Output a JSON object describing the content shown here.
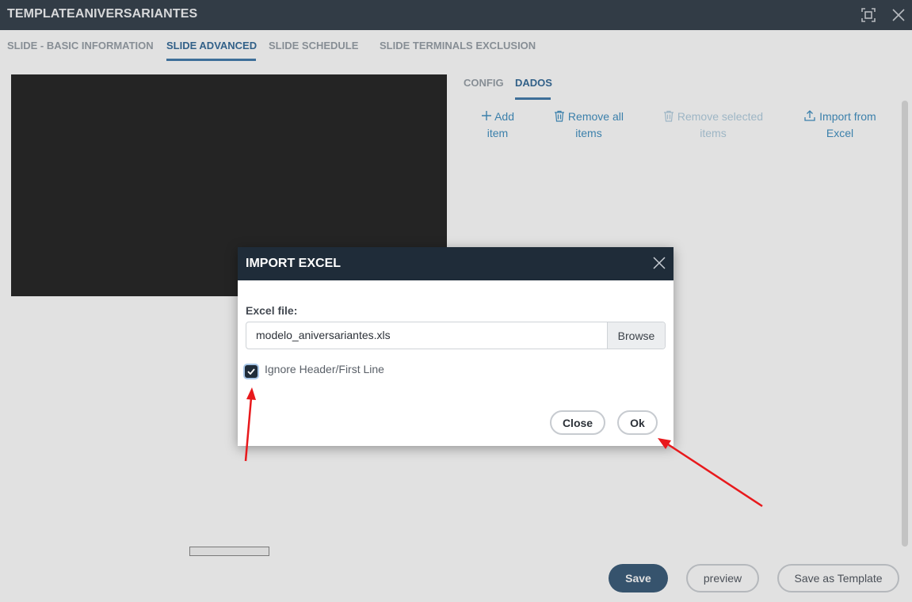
{
  "window": {
    "title": "TEMPLATEANIVERSARIANTES",
    "maximize_icon": "maximize-icon",
    "close_icon": "close-icon"
  },
  "tabs": [
    {
      "label": "SLIDE - BASIC INFORMATION"
    },
    {
      "label": "SLIDE ADVANCED",
      "active": true
    },
    {
      "label": "SLIDE SCHEDULE"
    },
    {
      "label": "SLIDE TERMINALS EXCLUSION"
    }
  ],
  "inner_tabs": [
    {
      "label": "CONFIG"
    },
    {
      "label": "DADOS",
      "active": true
    }
  ],
  "actions": {
    "add": {
      "line1": "Add",
      "line2": "item",
      "icon": "plus-icon"
    },
    "remove_all": {
      "line1": "Remove all",
      "line2": "items",
      "icon": "trash-icon"
    },
    "remove_selected": {
      "line1": "Remove selected",
      "line2": "items",
      "icon": "trash-icon"
    },
    "import": {
      "line1": "Import from",
      "line2": "Excel",
      "icon": "upload-icon"
    }
  },
  "footer": {
    "save": "Save",
    "preview": "preview",
    "save_template": "Save as Template"
  },
  "modal": {
    "title": "IMPORT EXCEL",
    "file_label": "Excel file:",
    "file_value": "modelo_aniversariantes.xls",
    "browse": "Browse",
    "checkbox_label": "Ignore Header/First Line",
    "checkbox_checked": true,
    "close": "Close",
    "ok": "Ok"
  },
  "colors": {
    "header_dark": "#1f2c39",
    "accent": "#2b83ba",
    "annotation_arrow": "#e8191c"
  }
}
